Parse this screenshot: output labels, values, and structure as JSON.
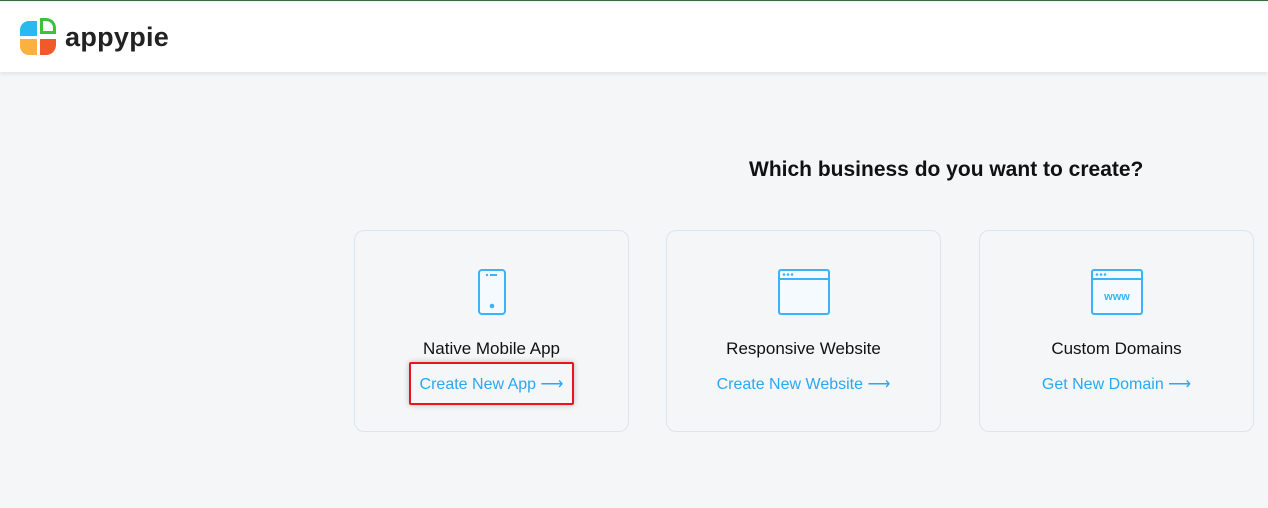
{
  "header": {
    "logo_text": "appypie"
  },
  "title": "Which business do you want to create?",
  "cards": [
    {
      "name": "Native Mobile App",
      "link": "Create New App",
      "icon": "mobile-phone-icon"
    },
    {
      "name": "Responsive Website",
      "link": "Create New Website",
      "icon": "browser-window-icon"
    },
    {
      "name": "Custom Domains",
      "link": "Get New Domain",
      "icon": "www-domain-icon"
    }
  ],
  "arrow": "⟶",
  "colors": {
    "accent": "#2aa8f2",
    "highlight": "#e8141a"
  }
}
